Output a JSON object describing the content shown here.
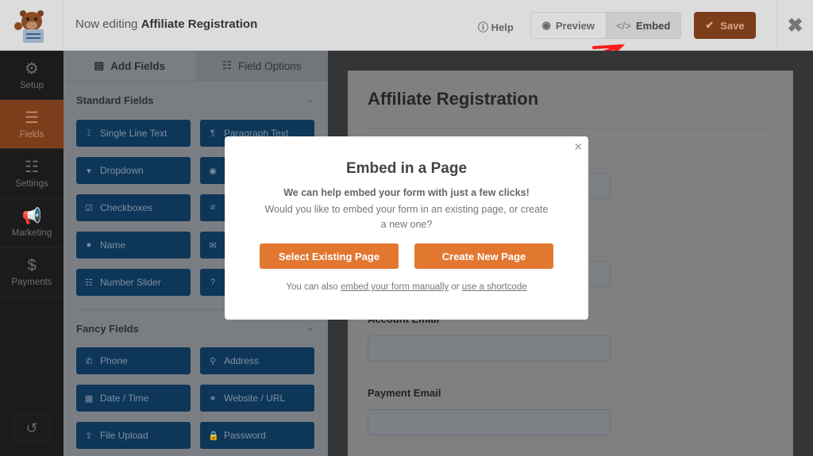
{
  "header": {
    "title_prefix": "Now editing",
    "form_name": "Affiliate Registration",
    "help": "Help",
    "preview": "Preview",
    "embed": "Embed",
    "save": "Save"
  },
  "sidebar": {
    "items": [
      {
        "label": "Setup",
        "icon": "gear-icon"
      },
      {
        "label": "Fields",
        "icon": "list-icon",
        "active": true
      },
      {
        "label": "Settings",
        "icon": "sliders-icon"
      },
      {
        "label": "Marketing",
        "icon": "megaphone-icon"
      },
      {
        "label": "Payments",
        "icon": "dollar-icon"
      }
    ]
  },
  "panel": {
    "tabs": [
      "Add Fields",
      "Field Options"
    ],
    "standard_title": "Standard Fields",
    "standard": [
      "Single Line Text",
      "Paragraph Text",
      "Dropdown",
      "",
      "Checkboxes",
      "",
      "Name",
      "",
      "Number Slider",
      ""
    ],
    "fancy_title": "Fancy Fields",
    "fancy": [
      "Phone",
      "Address",
      "Date / Time",
      "Website / URL",
      "File Upload",
      "Password"
    ]
  },
  "form": {
    "title": "Affiliate Registration",
    "labels": [
      "Account Email",
      "Payment Email"
    ]
  },
  "modal": {
    "title": "Embed in a Page",
    "bold": "We can help embed your form with just a few clicks!",
    "text": "Would you like to embed your form in an existing page, or create a new one?",
    "select": "Select Existing Page",
    "create": "Create New Page",
    "foot_prefix": "You can also",
    "link1": "embed your form manually",
    "or": "or",
    "link2": "use a shortcode"
  },
  "colors": {
    "accent": "#e27730",
    "field_button": "#0e3659",
    "annotation": "#ff1a1a"
  }
}
